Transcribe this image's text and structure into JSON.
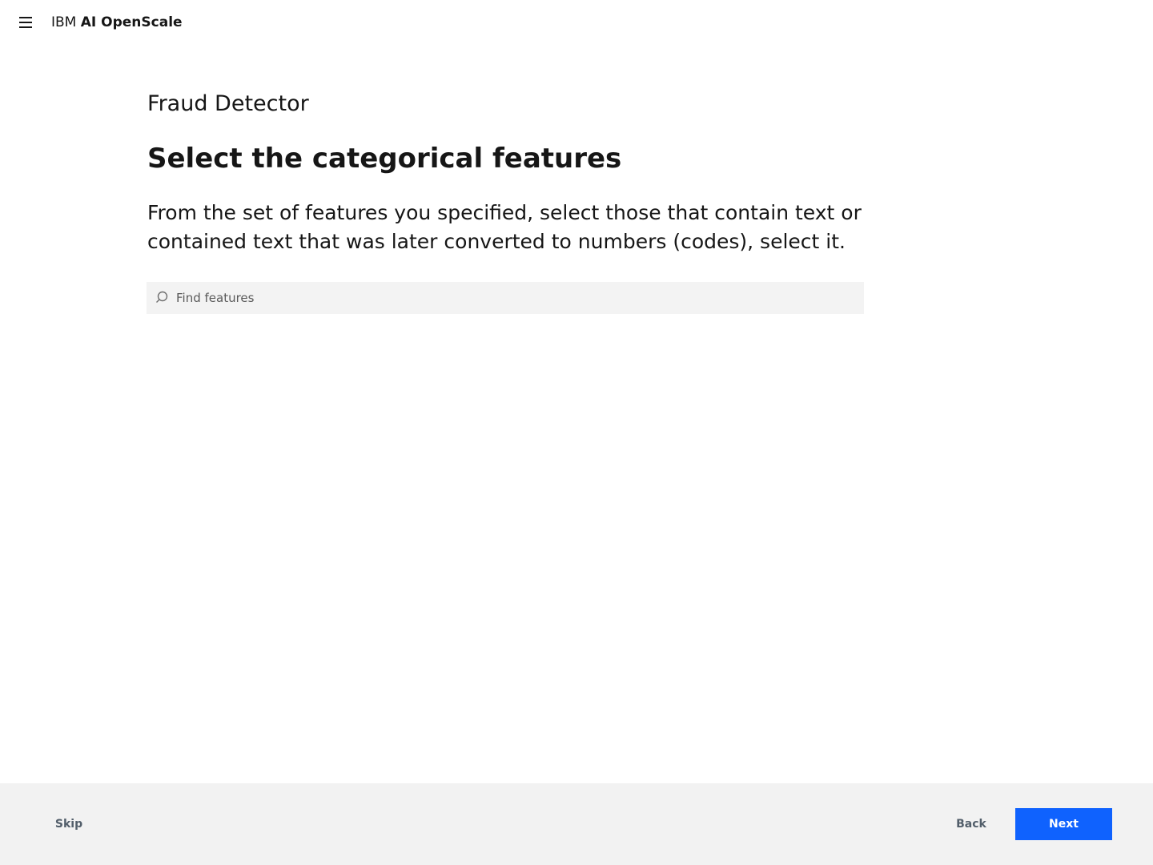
{
  "header": {
    "menu_icon": "hamburger-menu-icon",
    "brand_prefix": "IBM",
    "brand_product": "AI OpenScale"
  },
  "main": {
    "model_name": "Fraud Detector",
    "title": "Select the categorical features",
    "description": "From the set of features you specified, select those that contain text or contained text that was later converted to numbers (codes), select it.",
    "search": {
      "icon": "search-icon",
      "placeholder": "Find features",
      "value": ""
    }
  },
  "footer": {
    "skip_label": "Skip",
    "back_label": "Back",
    "next_label": "Next"
  },
  "colors": {
    "primary": "#0f62fe",
    "footer_bg": "#f2f2f2",
    "search_bg": "#f3f3f3",
    "secondary_text": "#525e6a"
  }
}
